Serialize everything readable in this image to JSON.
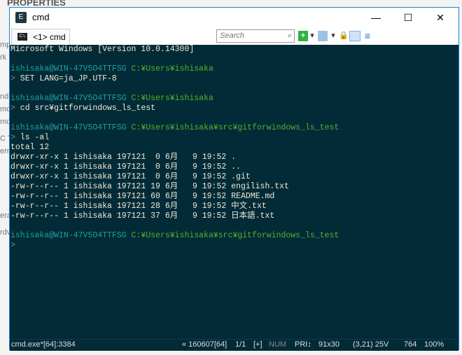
{
  "background": {
    "title": "PROPERTIES",
    "side_fragments": [
      "mp",
      "rk",
      "nd",
      "mo",
      "mo",
      "C Te",
      "ern",
      "era",
      "rdv"
    ]
  },
  "window": {
    "title": "cmd",
    "minimize": "—",
    "maximize": "☐",
    "close": "✕"
  },
  "tab": {
    "label": "<1> cmd",
    "icon_text": "C:\\."
  },
  "toolbar": {
    "search_placeholder": "Search",
    "new_console": "+",
    "dropdown": "▾",
    "lock": "🔒"
  },
  "console": {
    "colors": {
      "background": "#022b37",
      "user": "#1e9fa0",
      "path": "#56b02c",
      "text": "#eee8d5"
    },
    "lines": [
      {
        "text": "Microsoft Windows [Version 10.0.14300]"
      },
      {
        "text": ""
      },
      {
        "user": "ishisaka@WIN-47V5O4TTFSG",
        "path": "C:¥Users¥ishisaka"
      },
      {
        "prompt": ">",
        "text": " SET LANG=ja_JP.UTF-8"
      },
      {
        "text": ""
      },
      {
        "user": "ishisaka@WIN-47V5O4TTFSG",
        "path": "C:¥Users¥ishisaka"
      },
      {
        "prompt": ">",
        "text": " cd src¥gitforwindows_ls_test"
      },
      {
        "text": ""
      },
      {
        "user": "ishisaka@WIN-47V5O4TTFSG",
        "path": "C:¥Users¥ishisaka¥src¥gitforwindows_ls_test"
      },
      {
        "prompt": ">",
        "text": " ls -al"
      },
      {
        "text": "total 12"
      },
      {
        "text": "drwxr-xr-x 1 ishisaka 197121  0 6月   9 19:52 ."
      },
      {
        "text": "drwxr-xr-x 1 ishisaka 197121  0 6月   9 19:52 .."
      },
      {
        "text": "drwxr-xr-x 1 ishisaka 197121  0 6月   9 19:52 .git"
      },
      {
        "text": "-rw-r--r-- 1 ishisaka 197121 19 6月   9 19:52 engilish.txt"
      },
      {
        "text": "-rw-r--r-- 1 ishisaka 197121 60 6月   9 19:52 README.md"
      },
      {
        "text": "-rw-r--r-- 1 ishisaka 197121 28 6月   9 19:52 中文.txt"
      },
      {
        "text": "-rw-r--r-- 1 ishisaka 197121 37 6月   9 19:52 日本語.txt"
      },
      {
        "text": ""
      },
      {
        "user": "ishisaka@WIN-47V5O4TTFSG",
        "path": "C:¥Users¥ishisaka¥src¥gitforwindows_ls_test"
      },
      {
        "prompt": ">",
        "text": ""
      }
    ]
  },
  "status": {
    "process": "cmd.exe*[64]:3384",
    "build": "« 160607[64]",
    "page": "1/1",
    "plus": "[+]",
    "num": "NUM",
    "pri": "PRI↕",
    "size": "91x30",
    "cursor": "(3,21) 25V",
    "pid": "764",
    "zoom": "100%"
  }
}
